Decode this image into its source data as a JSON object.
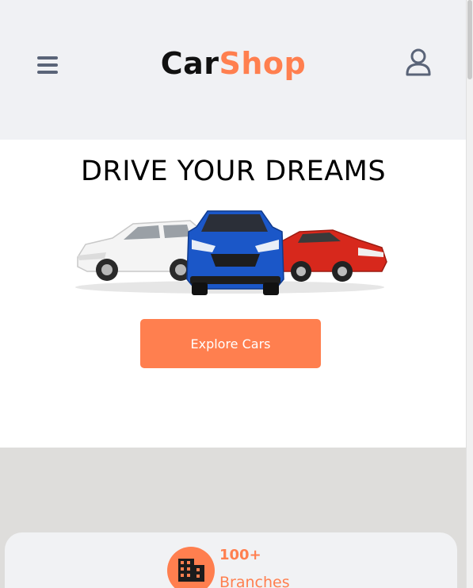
{
  "header": {
    "logo_part1": "Car",
    "logo_part2": "Shop"
  },
  "hero": {
    "title": "DRIVE YOUR DREAMS",
    "cta_label": "Explore Cars"
  },
  "stats": {
    "branches": {
      "count": "100+",
      "label": "Branches"
    }
  },
  "colors": {
    "accent": "#ff7f4f",
    "header_bg": "#f0f1f4",
    "icon_gray": "#5a6478"
  },
  "icons": [
    "hamburger-menu-icon",
    "user-icon",
    "building-icon"
  ]
}
